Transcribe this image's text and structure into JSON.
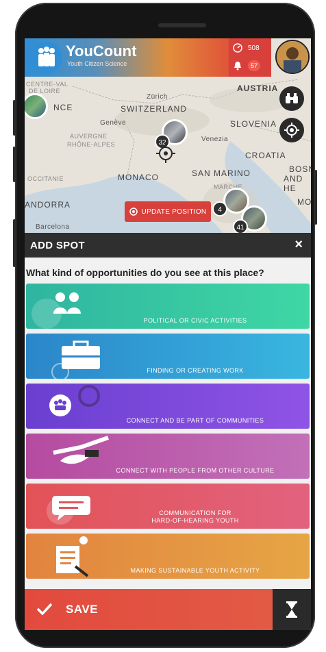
{
  "header": {
    "title": "YouCount",
    "subtitle": "Youth Citizen Science",
    "score_count": "508",
    "notification_count": "57"
  },
  "map": {
    "labels": {
      "centre_val": "CENTRE-VAL",
      "de_loire": "DE LOIRE",
      "nce": "NCE",
      "zurich": "Zürich",
      "switzerland": "SWITZERLAND",
      "austria": "AUSTRIA",
      "geneve": "Genève",
      "auvergne": "AUVERGNE",
      "rhone_alpes": "RHÔNE-ALPES",
      "venezia": "Venezia",
      "slovenia": "SLOVENIA",
      "croatia": "CROATIA",
      "occitanie": "OCCITANIE",
      "monaco": "MONACO",
      "san_marino": "SAN MARINO",
      "bosn": "BOSN",
      "and_he": "AND HE",
      "andorra": "ANDORRA",
      "marche": "MARCHE",
      "mo": "MO",
      "barcelona": "Barcelona"
    },
    "clusters": [
      "32",
      "4",
      "41"
    ],
    "update_label": "UPDATE POSITION"
  },
  "add_spot": {
    "title": "ADD SPOT",
    "close": "×",
    "question": "What kind of opportunities do you see at this place?",
    "options": [
      {
        "label": "POLITICAL OR CIVIC ACTIVITIES",
        "color_start": "#2fb5a0",
        "color_end": "#3fd7a4",
        "icon": "people-icon"
      },
      {
        "label": "FINDING OR CREATING WORK",
        "color_start": "#2b86c9",
        "color_end": "#39b6e0",
        "icon": "briefcase-icon"
      },
      {
        "label": "CONNECT AND BE PART OF COMMUNITIES",
        "color_start": "#6a3fd0",
        "color_end": "#8f54e6",
        "icon": "gear-group-icon"
      },
      {
        "label": "CONNECT WITH PEOPLE FROM OTHER CULTURE",
        "color_start": "#b54ba0",
        "color_end": "#c270b8",
        "icon": "handshake-icon"
      },
      {
        "label": "COMMUNICATION FOR\nHARD-OF-HEARING YOUTH",
        "color_start": "#e25357",
        "color_end": "#e2627e",
        "icon": "speech-bubble-icon"
      },
      {
        "label": "MAKING SUSTAINABLE YOUTH ACTIVITY",
        "color_start": "#e2843f",
        "color_end": "#e6a545",
        "icon": "document-idea-icon"
      }
    ]
  },
  "footer": {
    "save_label": "SAVE"
  }
}
